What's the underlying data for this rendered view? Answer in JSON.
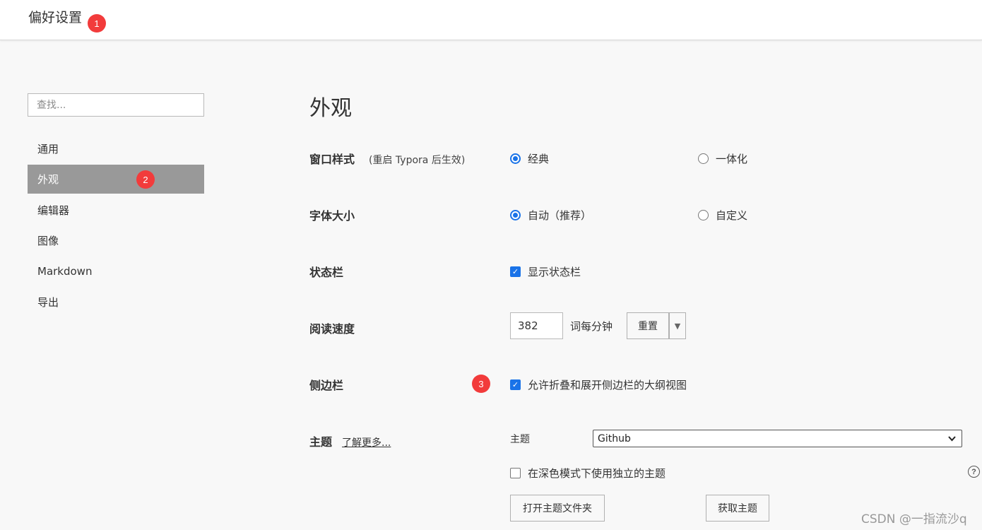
{
  "window": {
    "title": "偏好设置"
  },
  "markers": [
    "1",
    "2",
    "3"
  ],
  "search": {
    "placeholder": "查找..."
  },
  "sidebar": {
    "items": [
      {
        "label": "通用",
        "active": false
      },
      {
        "label": "外观",
        "active": true
      },
      {
        "label": "编辑器",
        "active": false
      },
      {
        "label": "图像",
        "active": false
      },
      {
        "label": "Markdown",
        "active": false
      },
      {
        "label": "导出",
        "active": false
      }
    ]
  },
  "main": {
    "title": "外观",
    "window_style": {
      "label": "窗口样式",
      "note": "(重启 Typora 后生效)",
      "options": [
        {
          "label": "经典",
          "selected": true
        },
        {
          "label": "一体化",
          "selected": false
        }
      ]
    },
    "font_size": {
      "label": "字体大小",
      "options": [
        {
          "label": "自动（推荐）",
          "selected": true
        },
        {
          "label": "自定义",
          "selected": false
        }
      ]
    },
    "status_bar": {
      "label": "状态栏",
      "checkbox": {
        "label": "显示状态栏",
        "checked": true
      }
    },
    "reading_speed": {
      "label": "阅读速度",
      "value": "382",
      "unit": "词每分钟",
      "reset_label": "重置",
      "dropdown_glyph": "▼"
    },
    "sidebar_setting": {
      "label": "侧边栏",
      "checkbox": {
        "label": "允许折叠和展开侧边栏的大纲视图",
        "checked": true
      }
    },
    "theme": {
      "label": "主题",
      "learn_more": "了解更多...",
      "sub_label": "主题",
      "selected": "Github",
      "dark_mode_checkbox": {
        "label": "在深色模式下使用独立的主题",
        "checked": false
      },
      "help_glyph": "?",
      "open_folder_label": "打开主题文件夹",
      "get_themes_label": "获取主题"
    }
  },
  "watermark": "CSDN @一指流沙q",
  "colors": {
    "accent": "#1a73e8",
    "active_nav": "#999999",
    "marker": "#f23b3b"
  }
}
